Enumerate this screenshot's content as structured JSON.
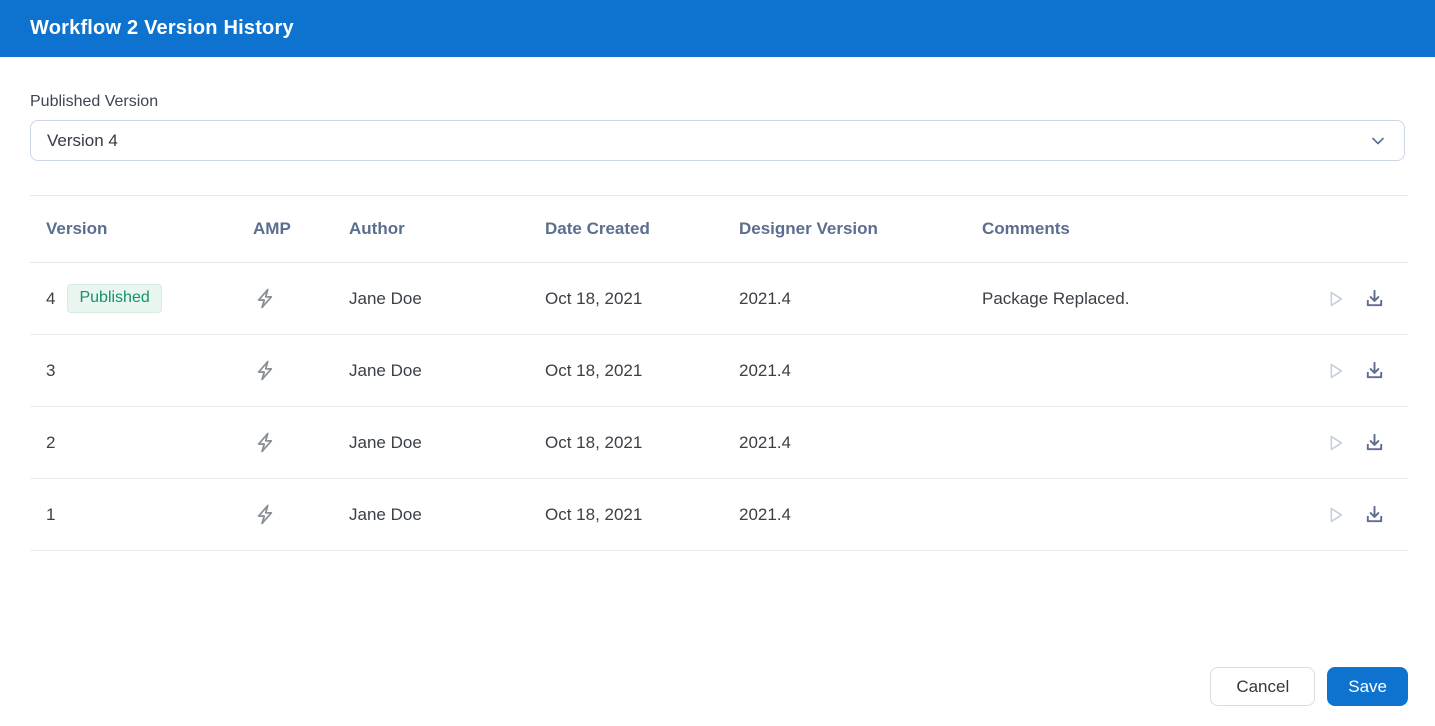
{
  "dialog": {
    "title": "Workflow 2 Version History"
  },
  "published_version": {
    "label": "Published Version",
    "selected": "Version 4"
  },
  "table": {
    "columns": [
      "Version",
      "AMP",
      "Author",
      "Date Created",
      "Designer Version",
      "Comments"
    ],
    "rows": [
      {
        "version": "4",
        "status_badge": "Published",
        "amp_icon": "lightning-bolt",
        "author": "Jane Doe",
        "date_created": "Oct 18, 2021",
        "designer_version": "2021.4",
        "comments": "Package Replaced."
      },
      {
        "version": "3",
        "status_badge": "",
        "amp_icon": "lightning-bolt",
        "author": "Jane Doe",
        "date_created": "Oct 18, 2021",
        "designer_version": "2021.4",
        "comments": ""
      },
      {
        "version": "2",
        "status_badge": "",
        "amp_icon": "lightning-bolt",
        "author": "Jane Doe",
        "date_created": "Oct 18, 2021",
        "designer_version": "2021.4",
        "comments": ""
      },
      {
        "version": "1",
        "status_badge": "",
        "amp_icon": "lightning-bolt",
        "author": "Jane Doe",
        "date_created": "Oct 18, 2021",
        "designer_version": "2021.4",
        "comments": ""
      }
    ],
    "row_actions": [
      "play",
      "download"
    ]
  },
  "footer": {
    "cancel_label": "Cancel",
    "save_label": "Save"
  },
  "colors": {
    "header_bg": "#0d73cf",
    "accent": "#0d73cf",
    "badge_text": "#14916c",
    "badge_bg": "#e9f6f0",
    "table_header_text": "#5b6e8f",
    "bolt_icon": "#8b9097",
    "play_icon": "#c7cfdf",
    "download_icon": "#5d6d90"
  }
}
